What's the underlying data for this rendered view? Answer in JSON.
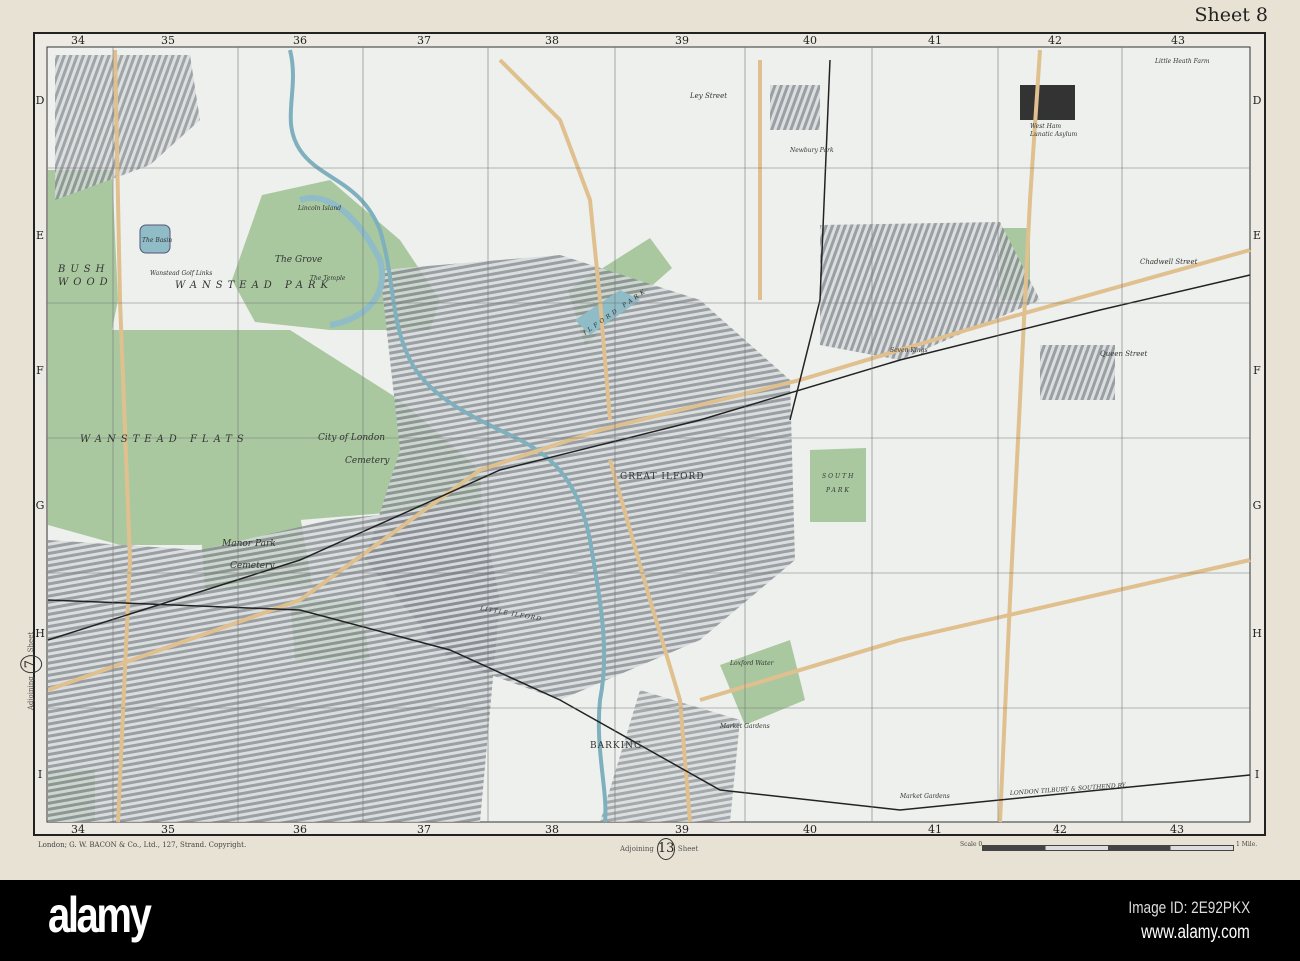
{
  "sheet_title": "Sheet 8",
  "grid": {
    "columns": [
      "34",
      "35",
      "36",
      "37",
      "38",
      "39",
      "40",
      "41",
      "42",
      "43"
    ],
    "rows": [
      "D",
      "E",
      "F",
      "G",
      "H",
      "I"
    ]
  },
  "labels": {
    "wanstead_park": "WANSTEAD PARK",
    "wanstead_flats": "WANSTEAD FLATS",
    "bush": "BUSH",
    "wood": "WOOD",
    "the_basin": "The Basin",
    "the_grove": "The Grove",
    "the_temple": "The Temple",
    "lincoln_island": "Lincoln Island",
    "golf_links": "Wanstead Golf Links",
    "city_of_london": "City of London",
    "cemetery_1": "Cemetery",
    "manor_park": "Manor Park",
    "cemetery_2": "Cemetery",
    "great_ilford": "GREAT ILFORD",
    "ilford_park": "ILFORD PARK",
    "south": "SOUTH",
    "park": "PARK",
    "little_ilford": "LITTLE ILFORD",
    "barking": "BARKING",
    "market_gardens_1": "Market Gardens",
    "market_gardens_2": "Market Gardens",
    "ley_street": "Ley Street",
    "newbury_park": "Newbury Park",
    "asylum_1": "West Ham",
    "asylum_2": "Lunatic Asylum",
    "chadwell_street": "Chadwell Street",
    "queen_street": "Queen Street",
    "seven_kings": "Seven Kings",
    "loxford_water": "Loxford Water",
    "little_heath_farm": "Little Heath Farm",
    "railway": "LONDON TILBURY & SOUTHEND RY."
  },
  "footer": {
    "publisher": "London; G. W. BACON & Co., Ltd., 127, Strand.   Copyright.",
    "adjoining_word": "Adjoining",
    "sheet_word": "Sheet",
    "adjoining_bottom": "13",
    "adjoining_left": "7",
    "scale_label": "Scale 0",
    "scale_end": "1 Mile."
  },
  "watermark": {
    "logo": "alamy",
    "image_id": "Image ID: 2E92PKX",
    "url": "www.alamy.com"
  },
  "colors": {
    "paper": "#e8e2d4",
    "map_bg": "#eef0ed",
    "parkland": "#a9c8a0",
    "water": "#8fbcc6",
    "road": "#dfc08e",
    "urban": "#8a8f94"
  }
}
